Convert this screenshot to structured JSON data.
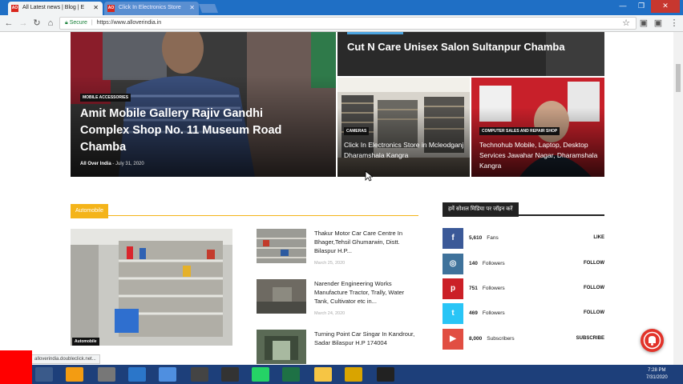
{
  "browser": {
    "tabs": [
      {
        "favicon": "AO",
        "title": "All Latest news | Blog | E"
      },
      {
        "favicon": "AO",
        "title": "Click In Electronics Store"
      }
    ],
    "secure_label": "Secure",
    "url": "https://www.alloverindia.in"
  },
  "featured": {
    "main": {
      "category": "MOBILE ACCESSORIES",
      "title": "Amit Mobile Gallery Rajiv Gandhi Complex Shop No. 11 Museum Road Chamba",
      "author": "All Over India",
      "date": "July 31, 2020"
    },
    "top_right": {
      "title": "Cut N Care Unisex Salon Sultanpur Chamba"
    },
    "mid": {
      "category": "CAMERAS",
      "title": "Click In Electronics Store in Mcleodganj Dharamshala Kangra"
    },
    "right": {
      "category": "COMPUTER SALES AND REPAIR SHOP",
      "title": "Technohub Mobile, Laptop, Desktop Services Jawahar Nagar, Dharamshala Kangra"
    }
  },
  "automobile": {
    "heading": "Automobile",
    "big_category": "Automobile",
    "posts": [
      {
        "title": "Thakur Motor Car Care Centre In Bhager,Tehsil Ghumarwin, Distt. Bilaspur H.P...",
        "date": "March 25, 2020"
      },
      {
        "title": "Narender Engineering Works Manufacture Tractor, Trally, Water Tank, Cultivator etc in...",
        "date": "March 24, 2020"
      },
      {
        "title": "Turning Point Car Singar In Kandrour, Sadar Bilaspur H.P 174004",
        "date": ""
      }
    ]
  },
  "social": {
    "heading": "हमें सोशल मिडिया पर जॉइन करें",
    "items": [
      {
        "icon": "facebook-icon",
        "glyph": "f",
        "count": "5,610",
        "label": "Fans",
        "action": "LIKE",
        "color": "#3b5998"
      },
      {
        "icon": "instagram-icon",
        "glyph": "◎",
        "count": "140",
        "label": "Followers",
        "action": "FOLLOW",
        "color": "#3f729b"
      },
      {
        "icon": "pinterest-icon",
        "glyph": "p",
        "count": "751",
        "label": "Followers",
        "action": "FOLLOW",
        "color": "#cb2027"
      },
      {
        "icon": "twitter-icon",
        "glyph": "t",
        "count": "469",
        "label": "Followers",
        "action": "FOLLOW",
        "color": "#29c5f6"
      },
      {
        "icon": "youtube-icon",
        "glyph": "▶",
        "count": "8,000",
        "label": "Subscribers",
        "action": "SUBSCRIBE",
        "color": "#e14e42"
      }
    ]
  },
  "status_url": "alloverindia.doubleclick.net...",
  "clock": {
    "time": "7:28 PM",
    "date": "7/31/2020"
  },
  "colors": {
    "accent": "#f4b41a",
    "taskbar": "#1d3f7a",
    "titlebar": "#1f6fc5"
  }
}
